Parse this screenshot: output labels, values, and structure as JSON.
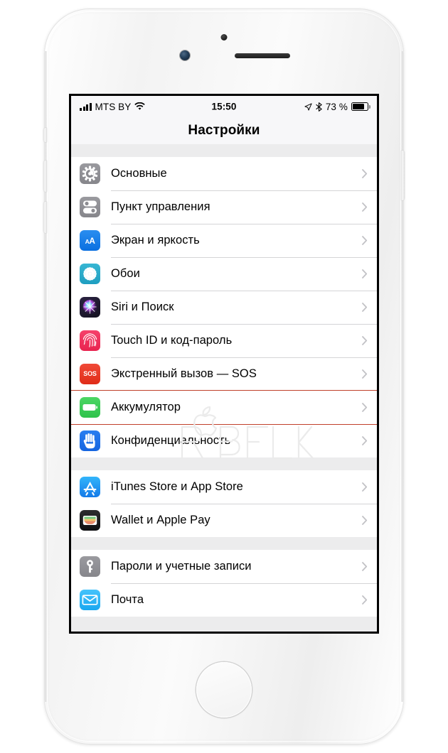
{
  "device": {
    "kind": "iphone",
    "body_color": "#f5f5f5",
    "hardware": {
      "front_camera": "front-camera",
      "earpiece": "earpiece-speaker",
      "proximity_sensor": "sensor-dot",
      "home_button": "home-button",
      "mute_switch": "mute-switch",
      "volume_up": "volume-up",
      "volume_down": "volume-down",
      "power_button": "power-button"
    }
  },
  "status_bar": {
    "carrier": "MTS BY",
    "signal_bars": 4,
    "wifi_icon": "wifi-icon",
    "time": "15:50",
    "location_icon": "location-arrow-icon",
    "bluetooth_icon": "bluetooth-icon",
    "battery_percent": "73 %",
    "battery_level": 73,
    "battery_icon": "battery-icon"
  },
  "nav_bar": {
    "title": "Настройки"
  },
  "highlight": {
    "target_row": "Аккумулятор",
    "color": "#c0402a"
  },
  "watermark": {
    "text": "ЯБЛЫК",
    "color": "#ebebeb"
  },
  "sections": [
    {
      "rows": [
        {
          "label": "Основные",
          "icon": "gear-icon",
          "icon_class": "ic-gear",
          "chevron": "chevron-right-icon"
        },
        {
          "label": "Пункт управления",
          "icon": "sliders-icon",
          "icon_class": "ic-control",
          "chevron": "chevron-right-icon"
        },
        {
          "label": "Экран и яркость",
          "icon": "display-aa-icon",
          "icon_class": "ic-display",
          "chevron": "chevron-right-icon"
        },
        {
          "label": "Обои",
          "icon": "wallpaper-icon",
          "icon_class": "ic-wallpaper",
          "chevron": "chevron-right-icon"
        },
        {
          "label": "Siri и Поиск",
          "icon": "siri-icon",
          "icon_class": "ic-siri",
          "chevron": "chevron-right-icon"
        },
        {
          "label": "Touch ID и код-пароль",
          "icon": "fingerprint-icon",
          "icon_class": "ic-touchid",
          "chevron": "chevron-right-icon"
        },
        {
          "label": "Экстренный вызов — SOS",
          "icon": "sos-icon",
          "icon_class": "ic-sos",
          "chevron": "chevron-right-icon"
        },
        {
          "label": "Аккумулятор",
          "icon": "battery-icon",
          "icon_class": "ic-battery",
          "chevron": "chevron-right-icon"
        },
        {
          "label": "Конфиденциальность",
          "icon": "hand-icon",
          "icon_class": "ic-privacy",
          "chevron": "chevron-right-icon"
        }
      ]
    },
    {
      "rows": [
        {
          "label": "iTunes Store и App Store",
          "icon": "app-store-icon",
          "icon_class": "ic-appstore",
          "chevron": "chevron-right-icon"
        },
        {
          "label": "Wallet и Apple Pay",
          "icon": "wallet-icon",
          "icon_class": "ic-wallet",
          "chevron": "chevron-right-icon"
        }
      ]
    },
    {
      "rows": [
        {
          "label": "Пароли и учетные записи",
          "icon": "key-icon",
          "icon_class": "ic-passwords",
          "chevron": "chevron-right-icon"
        },
        {
          "label": "Почта",
          "icon": "mail-icon",
          "icon_class": "ic-mail",
          "chevron": "chevron-right-icon"
        }
      ]
    }
  ]
}
